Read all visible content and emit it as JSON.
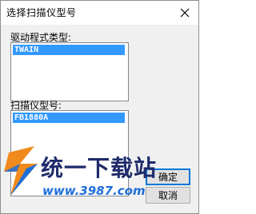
{
  "window": {
    "title": "选择扫描仪型号"
  },
  "driver": {
    "label": "驱动程式类型:",
    "items": [
      "TWAIN"
    ]
  },
  "scanner": {
    "label": "扫描仪型号:",
    "items": [
      "FB1880A"
    ]
  },
  "buttons": {
    "ok": "确定",
    "cancel": "取消"
  },
  "watermark": {
    "text": "统一下载站",
    "url": "www.3987.com"
  },
  "colors": {
    "selection": "#3399ff",
    "dialog_bg": "#f0f0f0",
    "watermark_orange": "#f08a1c",
    "watermark_blue": "#1e6fd9"
  }
}
